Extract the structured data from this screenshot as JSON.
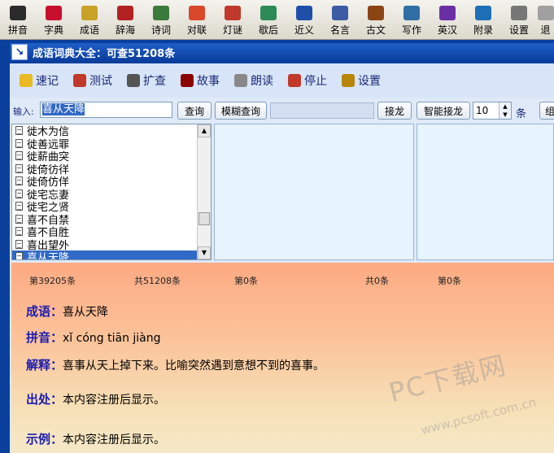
{
  "toolbar": {
    "items": [
      {
        "label": "拼音",
        "icon": "face-icon",
        "color": "#2b2b2b"
      },
      {
        "label": "字典",
        "icon": "red-book-icon",
        "color": "#c8102e"
      },
      {
        "label": "成语",
        "icon": "striped-book-icon",
        "color": "#c9a227"
      },
      {
        "label": "辞海",
        "icon": "stacked-books-icon",
        "color": "#b22222"
      },
      {
        "label": "诗词",
        "icon": "scroll-icon",
        "color": "#3d7a3d"
      },
      {
        "label": "对联",
        "icon": "couplet-icon",
        "color": "#d9482b"
      },
      {
        "label": "灯谜",
        "icon": "lantern-icon",
        "color": "#c0392b"
      },
      {
        "label": "歇后",
        "icon": "cards-icon",
        "color": "#2e8b57"
      },
      {
        "label": "近义",
        "icon": "open-book-icon",
        "color": "#1f4fa8"
      },
      {
        "label": "名言",
        "icon": "notepad-icon",
        "color": "#3b5ba5"
      },
      {
        "label": "古文",
        "icon": "ancient-book-icon",
        "color": "#8b4513"
      },
      {
        "label": "写作",
        "icon": "pen-icon",
        "color": "#2f6fa5"
      },
      {
        "label": "英汉",
        "icon": "bookshelf-icon",
        "color": "#6b2fa5"
      },
      {
        "label": "附录",
        "icon": "monitor-icon",
        "color": "#1f6fb5"
      },
      {
        "label": "设置",
        "icon": "gear-icon",
        "color": "#777777"
      },
      {
        "label": "退",
        "icon": "exit-icon",
        "color": "#a0a0a0"
      }
    ]
  },
  "window": {
    "title": "成语词典大全：可查51208条"
  },
  "actions": [
    {
      "label": "速记",
      "icon": "smiley-icon",
      "color": "#e8b923"
    },
    {
      "label": "测试",
      "icon": "car-icon",
      "color": "#c0392b"
    },
    {
      "label": "扩查",
      "icon": "arrows-icon",
      "color": "#555555"
    },
    {
      "label": "故事",
      "icon": "book-icon",
      "color": "#8b0000"
    },
    {
      "label": "朗读",
      "icon": "speaker-icon",
      "color": "#888888"
    },
    {
      "label": "停止",
      "icon": "stop-speaker-icon",
      "color": "#c0392b"
    },
    {
      "label": "设置",
      "icon": "settings-gear-icon",
      "color": "#b8860b"
    }
  ],
  "search": {
    "label": "输入:",
    "value": "喜从天降",
    "query_button": "查询",
    "fuzzy_button": "模糊查询",
    "chain_button": "接龙",
    "smart_chain_button": "智能接龙",
    "count_value": "10",
    "count_unit": "条",
    "extra_button": "组"
  },
  "list": {
    "items": [
      "徙木为信",
      "徙善远罪",
      "徙薪曲突",
      "徙倚彷徉",
      "徙倚仿佯",
      "徙宅忘妻",
      "徙宅之贤",
      "喜不自禁",
      "喜不自胜",
      "喜出望外",
      "喜从天降"
    ],
    "selected_index": 10
  },
  "stats": {
    "current": "第39205条",
    "total": "共51208条",
    "second_current": "第0条",
    "second_total": "共0条",
    "third_current": "第0条"
  },
  "detail": {
    "idiom_label": "成语：",
    "idiom": "喜从天降",
    "pinyin_label": "拼音：",
    "pinyin": "xǐ cóng tiān jiàng",
    "meaning_label": "解释：",
    "meaning": "喜事从天上掉下来。比喻突然遇到意想不到的喜事。",
    "source_label": "出处：",
    "source": "本内容注册后显示。",
    "example_label": "示例：",
    "example": "本内容注册后显示。"
  },
  "watermark": {
    "main": "PC下载网",
    "sub": "www.pcsoft.com.cn"
  }
}
